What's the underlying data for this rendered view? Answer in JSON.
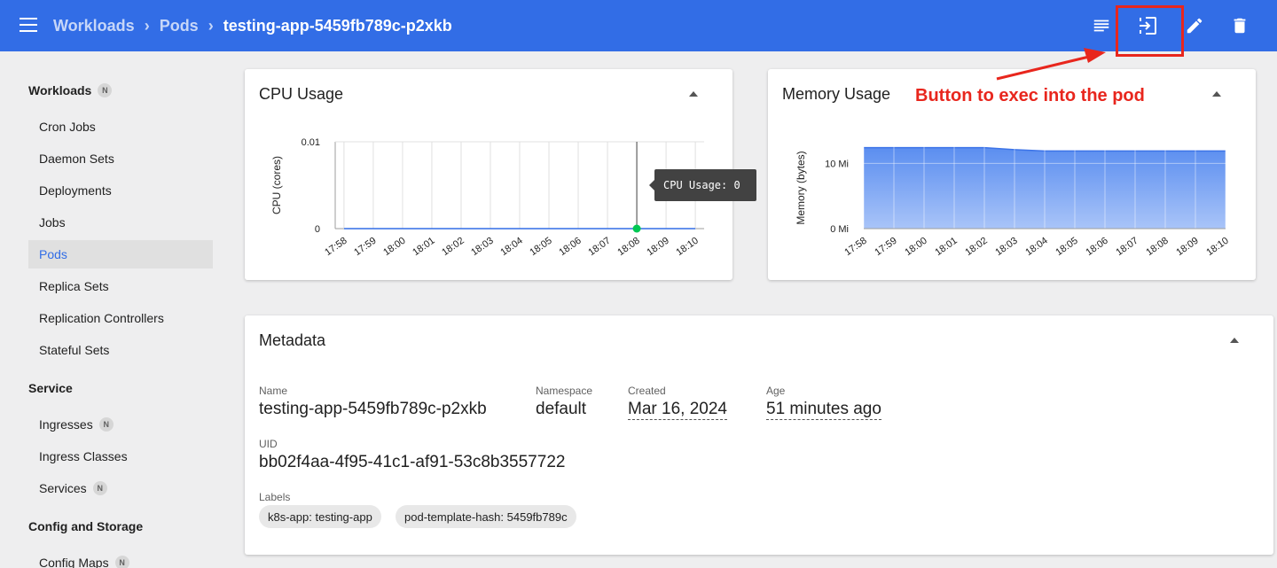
{
  "header": {
    "breadcrumb": [
      {
        "label": "Workloads"
      },
      {
        "label": "Pods"
      }
    ],
    "current": "testing-app-5459fb789c-p2xkb",
    "actions": [
      "logs-icon",
      "exec-icon",
      "edit-icon",
      "delete-icon"
    ]
  },
  "sidebar": {
    "groups": [
      {
        "label": "Workloads",
        "badge": "N"
      },
      {
        "label": "Service"
      },
      {
        "label": "Config and Storage"
      }
    ],
    "items": [
      {
        "label": "Cron Jobs"
      },
      {
        "label": "Daemon Sets"
      },
      {
        "label": "Deployments"
      },
      {
        "label": "Jobs"
      },
      {
        "label": "Pods",
        "active": true
      },
      {
        "label": "Replica Sets"
      },
      {
        "label": "Replication Controllers"
      },
      {
        "label": "Stateful Sets"
      },
      {
        "label": "Ingresses",
        "badge": "N"
      },
      {
        "label": "Ingress Classes"
      },
      {
        "label": "Services",
        "badge": "N"
      },
      {
        "label": "Config Maps",
        "badge": "N"
      }
    ]
  },
  "cpu_card": {
    "title": "CPU Usage",
    "tooltip": "CPU Usage: 0"
  },
  "memory_card": {
    "title": "Memory Usage",
    "annotation": "Button to exec into the pod"
  },
  "metadata": {
    "title": "Metadata",
    "name_label": "Name",
    "name": "testing-app-5459fb789c-p2xkb",
    "namespace_label": "Namespace",
    "namespace": "default",
    "created_label": "Created",
    "created": "Mar 16, 2024",
    "age_label": "Age",
    "age": "51 minutes ago",
    "uid_label": "UID",
    "uid": "bb02f4aa-4f95-41c1-af91-53c8b3557722",
    "labels_label": "Labels",
    "labels": [
      "k8s-app: testing-app",
      "pod-template-hash: 5459fb789c"
    ]
  },
  "colors": {
    "primary": "#326de6",
    "annotation": "#e8261d",
    "memory_fill": "#5b8ef0",
    "cpu_point": "#00c853"
  },
  "chart_data": [
    {
      "type": "line",
      "title": "CPU Usage",
      "xlabel": "",
      "ylabel": "CPU (cores)",
      "x": [
        "17:58",
        "17:59",
        "18:00",
        "18:01",
        "18:02",
        "18:03",
        "18:04",
        "18:05",
        "18:06",
        "18:07",
        "18:08",
        "18:09",
        "18:10"
      ],
      "yticks": [
        "0",
        "0.01"
      ],
      "ylim": [
        0,
        0.01
      ],
      "series": [
        {
          "values": [
            0,
            0,
            0,
            0,
            0,
            0,
            0,
            0,
            0,
            0,
            0,
            0,
            0
          ]
        }
      ],
      "highlight": {
        "x": "18:08",
        "y": 0
      },
      "grid": true
    },
    {
      "type": "area",
      "title": "Memory Usage",
      "xlabel": "",
      "ylabel": "Memory (bytes)",
      "x": [
        "17:58",
        "17:59",
        "18:00",
        "18:01",
        "18:02",
        "18:03",
        "18:04",
        "18:05",
        "18:06",
        "18:07",
        "18:08",
        "18:09",
        "18:10"
      ],
      "yticks": [
        "0 Mi",
        "10 Mi"
      ],
      "ylim_mi": [
        0,
        13.3
      ],
      "series": [
        {
          "values_mi": [
            12.4,
            12.4,
            12.4,
            12.4,
            12.4,
            12.1,
            11.9,
            11.9,
            11.9,
            11.9,
            11.9,
            11.9,
            11.9
          ]
        }
      ],
      "grid": true
    }
  ]
}
